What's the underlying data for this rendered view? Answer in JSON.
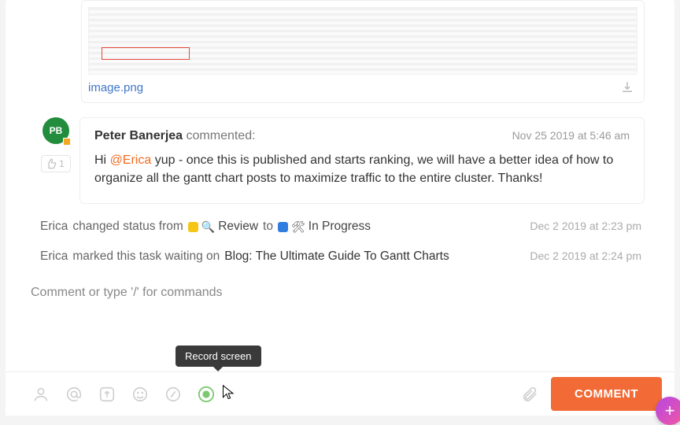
{
  "attachment": {
    "filename": "image.png"
  },
  "comment": {
    "avatar_initials": "PB",
    "author": "Peter Banerjea",
    "verb": " commented:",
    "timestamp": "Nov 25 2019 at 5:46 am",
    "like_count": "1",
    "body_prefix": "Hi ",
    "mention": "@Erica",
    "body_rest": " yup - once this is published and starts ranking, we will have a better idea of how to organize all the gantt chart posts to maximize traffic to the entire cluster. Thanks!"
  },
  "activity": [
    {
      "actor": "Erica",
      "text_before": " changed status from ",
      "from_status": "Review",
      "text_mid": " to ",
      "to_status": "In Progress",
      "timestamp": "Dec 2 2019 at 2:23 pm"
    },
    {
      "actor": "Erica",
      "text_before": " marked this task waiting on ",
      "link": "Blog: The Ultimate Guide To Gantt Charts",
      "timestamp": "Dec 2 2019 at 2:24 pm"
    }
  ],
  "composer": {
    "placeholder": "Comment or type '/' for commands",
    "tooltip": "Record screen",
    "button": "COMMENT"
  },
  "colors": {
    "accent": "#f26a36",
    "status_yellow": "#f5c518",
    "status_blue": "#2f7de1",
    "avatar_green": "#238d3e"
  }
}
